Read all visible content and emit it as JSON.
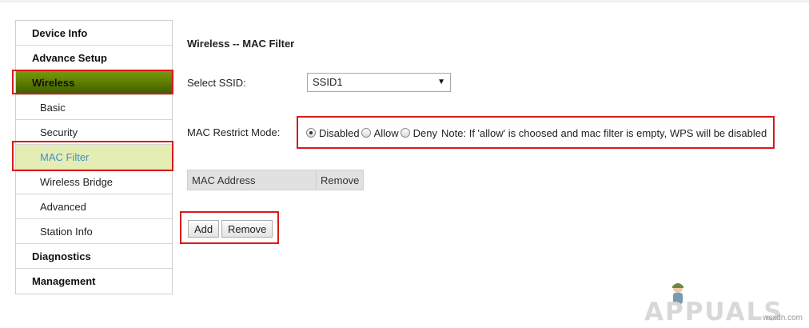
{
  "sidebar": {
    "items": [
      {
        "label": "Device Info"
      },
      {
        "label": "Advance Setup"
      },
      {
        "label": "Wireless"
      },
      {
        "label": "Basic"
      },
      {
        "label": "Security"
      },
      {
        "label": "MAC Filter"
      },
      {
        "label": "Wireless Bridge"
      },
      {
        "label": "Advanced"
      },
      {
        "label": "Station Info"
      },
      {
        "label": "Diagnostics"
      },
      {
        "label": "Management"
      }
    ],
    "active_section": "Wireless",
    "active_item": "MAC Filter"
  },
  "main": {
    "title": "Wireless -- MAC Filter",
    "ssid": {
      "label": "Select SSID:",
      "value": "SSID1",
      "arrow": "▼"
    },
    "restrict_mode": {
      "label": "MAC Restrict Mode:",
      "options": [
        "Disabled",
        "Allow",
        "Deny"
      ],
      "selected": "Disabled",
      "note": "Note: If 'allow' is choosed and mac filter is empty, WPS will be disabled"
    },
    "table": {
      "columns": [
        "MAC Address",
        "Remove"
      ],
      "rows": []
    },
    "buttons": {
      "add": "Add",
      "remove": "Remove"
    }
  },
  "watermark": {
    "logo": "APPUALS",
    "credit": "wsxdn.com"
  },
  "colors": {
    "highlight": "#d81b1b",
    "wireless_bg": "#5a7a00",
    "active_sub_bg": "#e4edb3",
    "active_sub_text": "#3f8fcf"
  }
}
